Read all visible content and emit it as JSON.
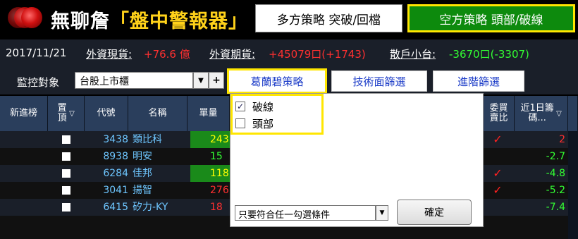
{
  "header": {
    "brand_prefix": "無聊詹",
    "brand_highlight": "「盤中警報器」",
    "long_strategy_label": "多方策略 突破/回檔",
    "short_strategy_label": "空方策略 頭部/破線"
  },
  "infobar": {
    "date": "2017/11/21",
    "foreign_spot_label": "外資現貨:",
    "foreign_spot_value": "+76.6 億",
    "foreign_futures_label": "外資期貨:",
    "foreign_futures_value": "+45079口(+1743)",
    "retail_mini_label": "散戶小台:",
    "retail_mini_value": "-3670口(-3307)"
  },
  "controls": {
    "monitor_label": "監控對象",
    "market_value": "台股上市櫃",
    "arrow": "▼",
    "plus": "+",
    "tab_gebilan": "葛蘭碧策略",
    "tab_technical": "技術面篩選",
    "tab_advanced": "進階篩選"
  },
  "table": {
    "headers": {
      "new_list": "新進榜",
      "pin_top": "置頂",
      "code": "代號",
      "name": "名稱",
      "volume": "單量",
      "order_ratio": "委買賣比",
      "chip_1d": "近1日籌碼..."
    },
    "filter_icon": "▽",
    "rows": [
      {
        "code": "3438",
        "name": "類比科",
        "volume": "243",
        "vol_style": "hl",
        "check": "✓",
        "change": "2",
        "change_color": "#ff3030"
      },
      {
        "code": "8938",
        "name": "明安",
        "volume": "15",
        "vol_style": "g2",
        "check": "",
        "change": "-2.7",
        "change_color": "#33ff33"
      },
      {
        "code": "6284",
        "name": "佳邦",
        "volume": "118",
        "vol_style": "hl",
        "check": "✓",
        "change": "-4.8",
        "change_color": "#33ff33"
      },
      {
        "code": "3041",
        "name": "揚智",
        "volume": "276",
        "vol_style": "r",
        "check": "✓",
        "change": "-5.2",
        "change_color": "#33ff33"
      },
      {
        "code": "6415",
        "name": "矽力-KY",
        "volume": "18",
        "vol_style": "r",
        "check": "",
        "change": "-7.4",
        "change_color": "#33ff33"
      }
    ]
  },
  "popup": {
    "options": [
      {
        "label": "破線",
        "checked": "✓"
      },
      {
        "label": "頭部",
        "checked": ""
      }
    ],
    "mode_value": "只要符合任一勾選條件",
    "mode_arrow": "▼",
    "ok_label": "確定"
  },
  "colors": {
    "accent_yellow": "#ffe600",
    "short_green": "#0d8a0d",
    "up_red": "#ff3030",
    "down_green": "#33ff33",
    "header_blue": "#2a3e5c"
  }
}
